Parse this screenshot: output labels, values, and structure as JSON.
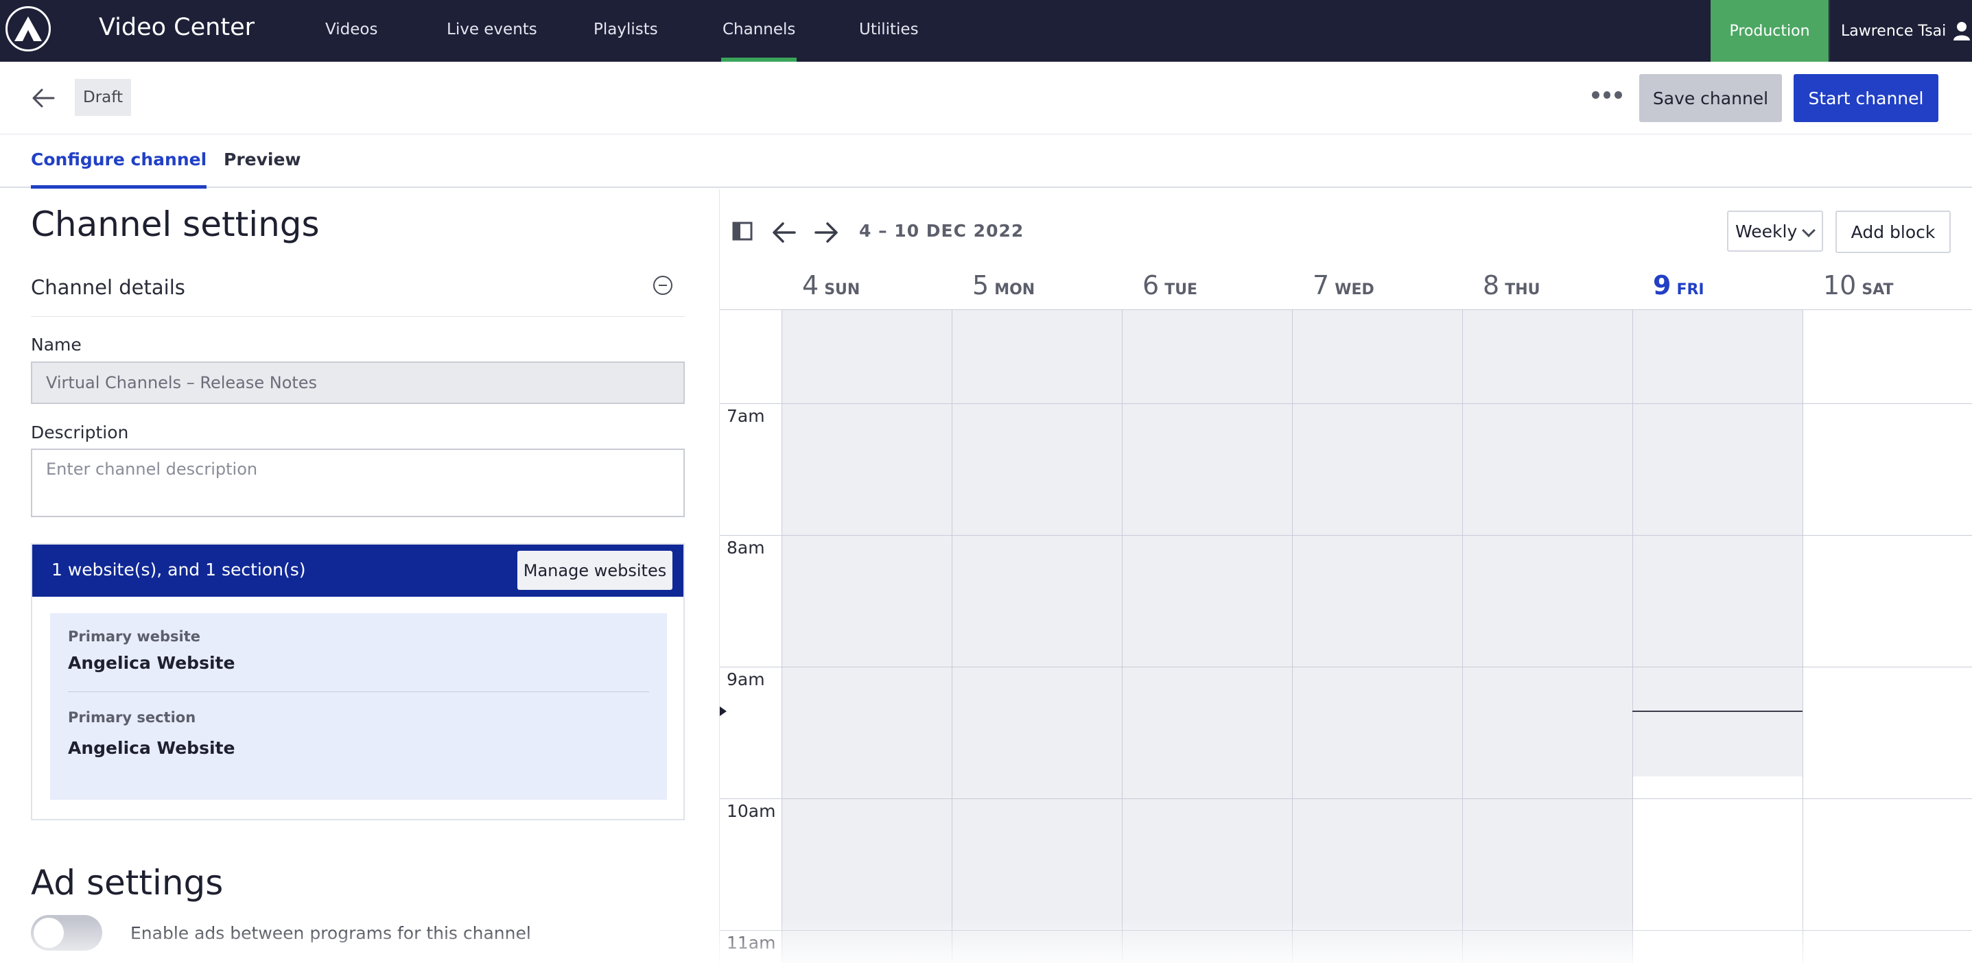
{
  "app": {
    "title": "Video Center",
    "nav": [
      {
        "label": "Videos"
      },
      {
        "label": "Live events"
      },
      {
        "label": "Playlists"
      },
      {
        "label": "Channels",
        "active": true
      },
      {
        "label": "Utilities"
      }
    ],
    "environment": "Production",
    "user_name": "Lawrence Tsai",
    "colors": {
      "nav_bg": "#1d2037",
      "accent": "#2140c6",
      "env": "#4ca763",
      "active_underline": "#3aa55a"
    }
  },
  "actionbar": {
    "status": "Draft",
    "save_label": "Save channel",
    "start_label": "Start channel"
  },
  "tabs": [
    {
      "label": "Configure channel",
      "active": true
    },
    {
      "label": "Preview"
    }
  ],
  "settings": {
    "title": "Channel settings",
    "details_title": "Channel details",
    "name_label": "Name",
    "name_value": "Virtual Channels – Release Notes",
    "description_label": "Description",
    "description_placeholder": "Enter channel description",
    "websites_summary": "1 website(s), and 1 section(s)",
    "manage_websites_label": "Manage websites",
    "primary_website_label": "Primary website",
    "primary_website_value": "Angelica Website",
    "primary_section_label": "Primary section",
    "primary_section_value": "Angelica Website",
    "ad_title": "Ad settings",
    "ad_toggle_label": "Enable ads between programs for this channel",
    "ad_toggle_on": false
  },
  "calendar": {
    "range": "4 – 10 DEC 2022",
    "view": "Weekly",
    "add_block_label": "Add block",
    "days": [
      {
        "num": "4",
        "dow": "SUN"
      },
      {
        "num": "5",
        "dow": "MON"
      },
      {
        "num": "6",
        "dow": "TUE"
      },
      {
        "num": "7",
        "dow": "WED"
      },
      {
        "num": "8",
        "dow": "THU"
      },
      {
        "num": "9",
        "dow": "FRI",
        "today": true
      },
      {
        "num": "10",
        "dow": "SAT"
      }
    ],
    "times": [
      "7am",
      "8am",
      "9am",
      "10am",
      "11am"
    ]
  }
}
